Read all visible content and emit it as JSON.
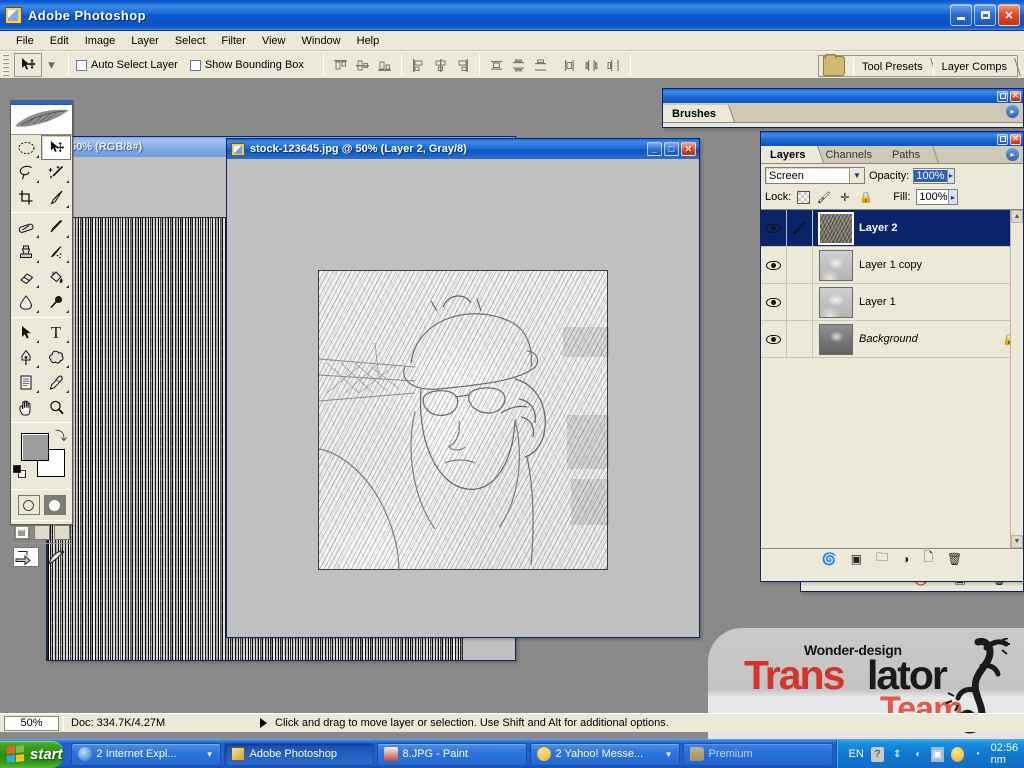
{
  "app": {
    "title": "Adobe Photoshop",
    "icon": "photoshop-icon",
    "window_buttons": {
      "minimize": "_",
      "maximize": "□",
      "close": "✕"
    }
  },
  "menubar": {
    "items": [
      "File",
      "Edit",
      "Image",
      "Layer",
      "Select",
      "Filter",
      "View",
      "Window",
      "Help"
    ]
  },
  "options_bar": {
    "tool_icon": "move-tool-icon",
    "tool_dropdown": "▾",
    "checkboxes": [
      {
        "label": "Auto Select Layer",
        "checked": false
      },
      {
        "label": "Show Bounding Box",
        "checked": false
      }
    ],
    "align_group_1": [
      "align-top-edges",
      "align-vertical-centers",
      "align-bottom-edges"
    ],
    "align_group_2": [
      "align-left-edges",
      "align-horizontal-centers",
      "align-right-edges"
    ],
    "distribute_group_1": [
      "distribute-top-edges",
      "distribute-vertical-centers",
      "distribute-bottom-edges"
    ],
    "distribute_group_2": [
      "distribute-left-edges",
      "distribute-horizontal-centers",
      "distribute-right-edges"
    ],
    "palette_well": {
      "folder_icon": "file-browser-icon",
      "tabs": [
        "Tool Presets",
        "Layer Comps"
      ]
    }
  },
  "toolbox": {
    "tools": [
      {
        "name": "marquee-tool",
        "glyph": "◯",
        "has_flyout": true,
        "selected": false
      },
      {
        "name": "move-tool",
        "glyph": "➤",
        "has_flyout": false,
        "selected": true
      },
      {
        "name": "lasso-tool",
        "glyph": "ᗡ",
        "has_flyout": true,
        "selected": false
      },
      {
        "name": "magic-wand-tool",
        "glyph": "✳",
        "has_flyout": true,
        "selected": false
      },
      {
        "name": "crop-tool",
        "glyph": "⌗",
        "has_flyout": false,
        "selected": false
      },
      {
        "name": "slice-tool",
        "glyph": "✂",
        "has_flyout": true,
        "selected": false
      },
      {
        "name": "healing-brush-tool",
        "glyph": "✏",
        "has_flyout": true,
        "selected": false
      },
      {
        "name": "brush-tool",
        "glyph": "🖌",
        "has_flyout": true,
        "selected": false
      },
      {
        "name": "clone-stamp-tool",
        "glyph": "⚲",
        "has_flyout": true,
        "selected": false
      },
      {
        "name": "history-brush-tool",
        "glyph": "✒",
        "has_flyout": true,
        "selected": false
      },
      {
        "name": "eraser-tool",
        "glyph": "▱",
        "has_flyout": true,
        "selected": false
      },
      {
        "name": "gradient-paint-bucket-tool",
        "glyph": "◣",
        "has_flyout": true,
        "selected": false
      },
      {
        "name": "blur-tool",
        "glyph": "💧",
        "has_flyout": true,
        "selected": false
      },
      {
        "name": "dodge-burn-tool",
        "glyph": "🔍",
        "has_flyout": true,
        "selected": false
      },
      {
        "name": "path-selection-tool",
        "glyph": "➤",
        "has_flyout": true,
        "selected": false
      },
      {
        "name": "type-tool",
        "glyph": "T",
        "has_flyout": true,
        "selected": false
      },
      {
        "name": "pen-tool",
        "glyph": "✎",
        "has_flyout": true,
        "selected": false
      },
      {
        "name": "custom-shape-tool",
        "glyph": "✿",
        "has_flyout": true,
        "selected": false
      },
      {
        "name": "notes-tool",
        "glyph": "▤",
        "has_flyout": true,
        "selected": false
      },
      {
        "name": "eyedropper-tool",
        "glyph": "✐",
        "has_flyout": true,
        "selected": false
      },
      {
        "name": "hand-tool",
        "glyph": "✋",
        "has_flyout": false,
        "selected": false
      },
      {
        "name": "zoom-tool",
        "glyph": "🔍",
        "has_flyout": false,
        "selected": false
      }
    ],
    "foreground_color": "#9d9d9d",
    "background_color": "#ffffff",
    "swap_icon": "swap-colors-icon",
    "default_colors_icon": "default-colors-icon",
    "mask_modes": [
      "standard-mask-mode",
      "quick-mask-mode"
    ],
    "screen_modes": [
      "standard-screen-mode",
      "full-screen-with-menubar",
      "full-screen-mode"
    ],
    "jump_buttons": [
      "jump-to-imageready",
      "brush-preview"
    ]
  },
  "documents": [
    {
      "title": "50% (RGB/8#)",
      "active": false,
      "zoom": "50%",
      "mode": "RGB/8#"
    },
    {
      "title": "stock-123645.jpg @ 50% (Layer 2, Gray/8)",
      "active": true,
      "filename": "stock-123645.jpg",
      "zoom": "50%",
      "layer": "Layer 2",
      "mode": "Gray/8"
    }
  ],
  "brushes_palette": {
    "tab": "Brushes",
    "menu_icon": "palette-menu-icon"
  },
  "layers_palette": {
    "tabs": [
      {
        "label": "Layers",
        "active": true
      },
      {
        "label": "Channels",
        "active": false
      },
      {
        "label": "Paths",
        "active": false
      }
    ],
    "menu_icon": "palette-menu-icon",
    "blend_mode": "Screen",
    "opacity_label": "Opacity:",
    "opacity_value": "100%",
    "lock_label": "Lock:",
    "lock_icons": [
      "lock-transparent-pixels-icon",
      "lock-image-pixels-icon",
      "lock-position-icon",
      "lock-all-icon"
    ],
    "fill_label": "Fill:",
    "fill_value": "100%",
    "layers": [
      {
        "name": "Layer 2",
        "selected": true,
        "visible": true,
        "column_icon": "brush-icon",
        "locked": false,
        "italic": false
      },
      {
        "name": "Layer 1 copy",
        "selected": false,
        "visible": true,
        "column_icon": "",
        "locked": false,
        "italic": false
      },
      {
        "name": "Layer 1",
        "selected": false,
        "visible": true,
        "column_icon": "",
        "locked": false,
        "italic": false
      },
      {
        "name": "Background",
        "selected": false,
        "visible": true,
        "column_icon": "",
        "locked": true,
        "italic": true
      }
    ],
    "footer_icons": [
      "link-layers-icon",
      "layer-style-icon",
      "add-layer-mask-icon",
      "new-group-icon",
      "new-adjustment-layer-icon",
      "new-layer-icon",
      "delete-layer-icon"
    ]
  },
  "status_bar": {
    "zoom": "50%",
    "doc_info": "Doc: 334.7K/4.27M",
    "hint": "Click and drag to move layer or selection.  Use Shift and Alt for additional options."
  },
  "taskbar": {
    "start_label": "start",
    "buttons": [
      {
        "label": "2 Internet Expl...",
        "icon": "internet-explorer-icon",
        "icon_color": "#1a6fc4",
        "active": false,
        "has_arrow": true
      },
      {
        "label": "Adobe Photoshop",
        "icon": "photoshop-icon",
        "icon_color": "#e8c96a",
        "active": true,
        "has_arrow": false
      },
      {
        "label": "8.JPG - Paint",
        "icon": "paint-icon",
        "icon_color": "#c8483a",
        "active": false,
        "has_arrow": false
      },
      {
        "label": "2 Yahoo! Messe...",
        "icon": "yahoo-messenger-icon",
        "icon_color": "#f0c020",
        "active": false,
        "has_arrow": true
      },
      {
        "label": "Premium",
        "icon": "folder-icon",
        "icon_color": "#e8b84a",
        "active": false,
        "has_arrow": false
      }
    ],
    "tray": {
      "language": "EN",
      "icons": [
        "help-icon",
        "updates-icon",
        "volume-icon",
        "network-icon",
        "messenger-icon",
        "shield-icon"
      ],
      "clock": "02:56 nm"
    }
  },
  "watermark": {
    "small_text": "Wonder-design",
    "main_red": "Trans",
    "main_black": "lator",
    "sub_text": "Team",
    "gecko": "gecko-logo-icon",
    "red": "#d8332b",
    "black": "#1a1a1a",
    "coral": "#e0584a"
  }
}
